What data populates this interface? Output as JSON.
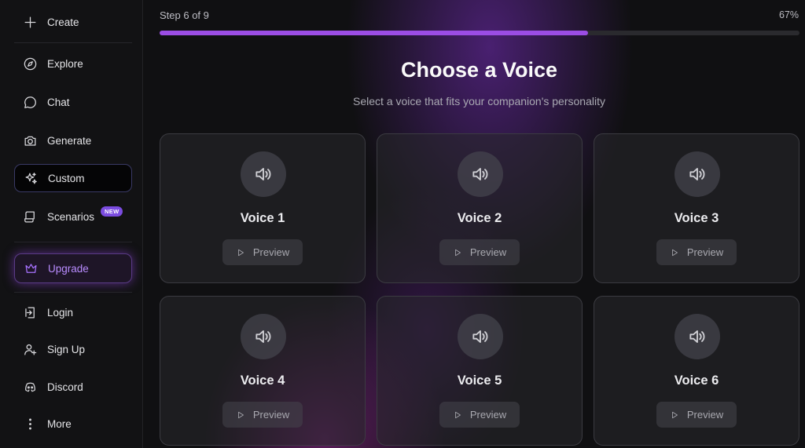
{
  "sidebar": {
    "items": [
      {
        "id": "create",
        "label": "Create",
        "icon": "plus-icon"
      },
      {
        "id": "explore",
        "label": "Explore",
        "icon": "compass-icon"
      },
      {
        "id": "chat",
        "label": "Chat",
        "icon": "chat-bubble-icon"
      },
      {
        "id": "generate",
        "label": "Generate",
        "icon": "camera-icon"
      },
      {
        "id": "custom",
        "label": "Custom",
        "icon": "sparkles-icon",
        "active": true
      },
      {
        "id": "scenarios",
        "label": "Scenarios",
        "icon": "scroll-icon",
        "badge": "NEW"
      },
      {
        "id": "upgrade",
        "label": "Upgrade",
        "icon": "crown-icon"
      },
      {
        "id": "login",
        "label": "Login",
        "icon": "login-icon"
      },
      {
        "id": "signup",
        "label": "Sign Up",
        "icon": "user-plus-icon"
      },
      {
        "id": "discord",
        "label": "Discord",
        "icon": "discord-icon"
      },
      {
        "id": "more",
        "label": "More",
        "icon": "more-vertical-icon"
      }
    ]
  },
  "progress": {
    "step_text": "Step 6 of 9",
    "percent_text": "67%",
    "value": 0.67
  },
  "heading": {
    "title": "Choose a Voice",
    "subtitle": "Select a voice that fits your companion's personality"
  },
  "voices": [
    {
      "name": "Voice 1",
      "preview_label": "Preview"
    },
    {
      "name": "Voice 2",
      "preview_label": "Preview"
    },
    {
      "name": "Voice 3",
      "preview_label": "Preview"
    },
    {
      "name": "Voice 4",
      "preview_label": "Preview"
    },
    {
      "name": "Voice 5",
      "preview_label": "Preview"
    },
    {
      "name": "Voice 6",
      "preview_label": "Preview"
    }
  ],
  "colors": {
    "accent": "#9b4de4",
    "upgrade_text": "#b98cff",
    "badge": "#7b4ce0"
  }
}
